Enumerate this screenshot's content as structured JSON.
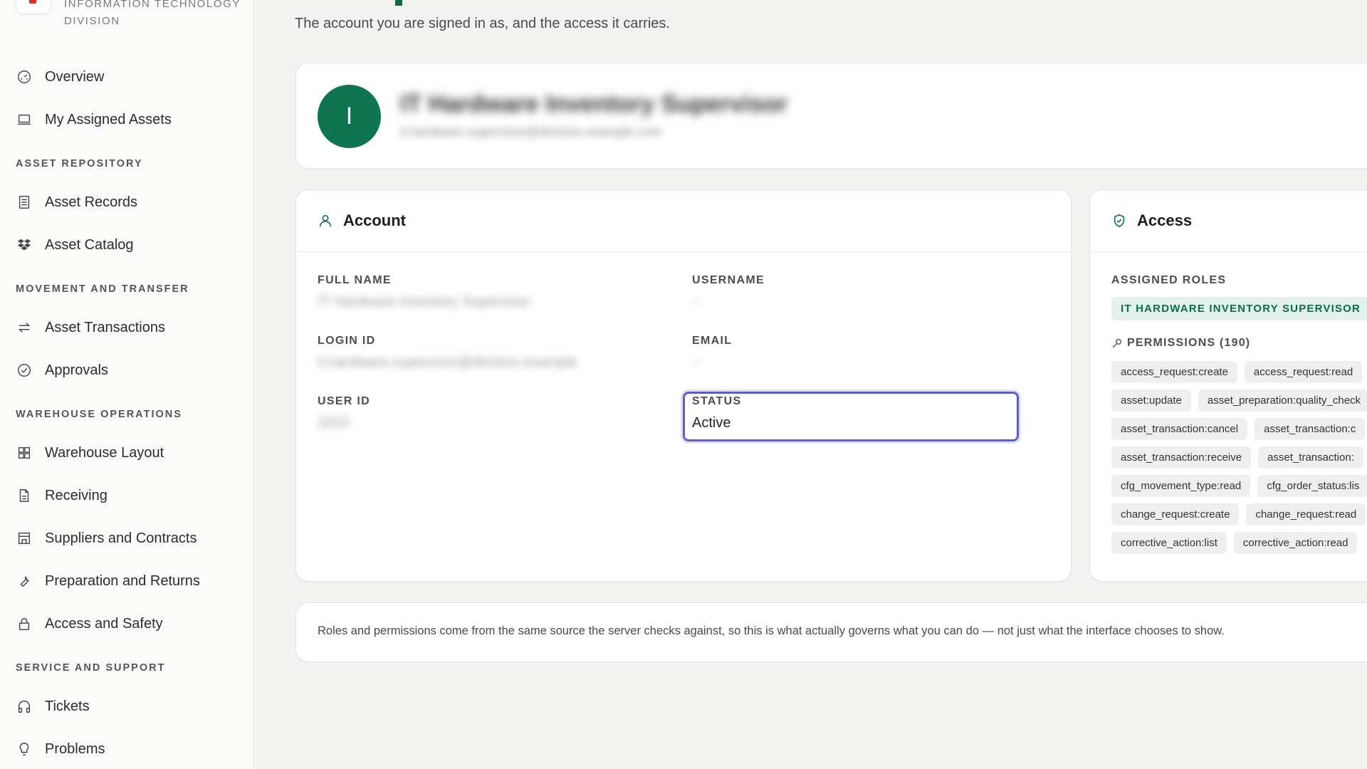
{
  "brand": {
    "name": "INFORMATION TECHNOLOGY DIVISION"
  },
  "sidebar": {
    "top": [
      {
        "label": "Overview",
        "icon": "dashboard-gauge-icon"
      },
      {
        "label": "My Assigned Assets",
        "icon": "laptop-icon"
      }
    ],
    "sections": [
      {
        "title": "ASSET REPOSITORY",
        "items": [
          {
            "label": "Asset Records",
            "icon": "records-icon"
          },
          {
            "label": "Asset Catalog",
            "icon": "dropbox-icon"
          }
        ]
      },
      {
        "title": "MOVEMENT AND TRANSFER",
        "items": [
          {
            "label": "Asset Transactions",
            "icon": "transfer-arrows-icon"
          },
          {
            "label": "Approvals",
            "icon": "check-circle-icon"
          }
        ]
      },
      {
        "title": "WAREHOUSE OPERATIONS",
        "items": [
          {
            "label": "Warehouse Layout",
            "icon": "grid-icon"
          },
          {
            "label": "Receiving",
            "icon": "document-icon"
          },
          {
            "label": "Suppliers and Contracts",
            "icon": "store-icon"
          },
          {
            "label": "Preparation and Returns",
            "icon": "wrench-icon"
          },
          {
            "label": "Access and Safety",
            "icon": "lock-icon"
          }
        ]
      },
      {
        "title": "SERVICE AND SUPPORT",
        "items": [
          {
            "label": "Tickets",
            "icon": "headphones-icon"
          },
          {
            "label": "Problems",
            "icon": "lightbulb-icon"
          }
        ]
      }
    ]
  },
  "page": {
    "subtitle": "The account you are signed in as, and the access it carries."
  },
  "profile": {
    "avatar_initial": "I",
    "display_name": "IT Hardware Inventory Supervisor",
    "email": "it.hardware.supervisor@division.example.com"
  },
  "account": {
    "title": "Account",
    "full_name_label": "FULL NAME",
    "full_name_value": "IT Hardware Inventory Supervisor",
    "username_label": "USERNAME",
    "username_value": "--",
    "login_id_label": "LOGIN ID",
    "login_id_value": "it.hardware.supervisor@division.example",
    "email_label": "EMAIL",
    "email_value": "--",
    "user_id_label": "USER ID",
    "user_id_value": "1023",
    "status_label": "STATUS",
    "status_value": "Active"
  },
  "access": {
    "title": "Access",
    "roles_label": "ASSIGNED ROLES",
    "role": "IT HARDWARE INVENTORY SUPERVISOR",
    "permissions_label": "PERMISSIONS (190)",
    "permissions": [
      [
        "access_request:create",
        "access_request:read"
      ],
      [
        "asset:update",
        "asset_preparation:quality_check"
      ],
      [
        "asset_transaction:cancel",
        "asset_transaction:c"
      ],
      [
        "asset_transaction:receive",
        "asset_transaction:"
      ],
      [
        "cfg_movement_type:read",
        "cfg_order_status:lis"
      ],
      [
        "change_request:create",
        "change_request:read"
      ],
      [
        "corrective_action:list",
        "corrective_action:read"
      ]
    ]
  },
  "note": {
    "text": "Roles and permissions come from the same source the server checks against, so this is what actually governs what you can do — not just what the interface chooses to show."
  },
  "colors": {
    "accent": "#0f7550",
    "focus": "#5c5fc9",
    "role_bg": "#e3f3ec"
  }
}
